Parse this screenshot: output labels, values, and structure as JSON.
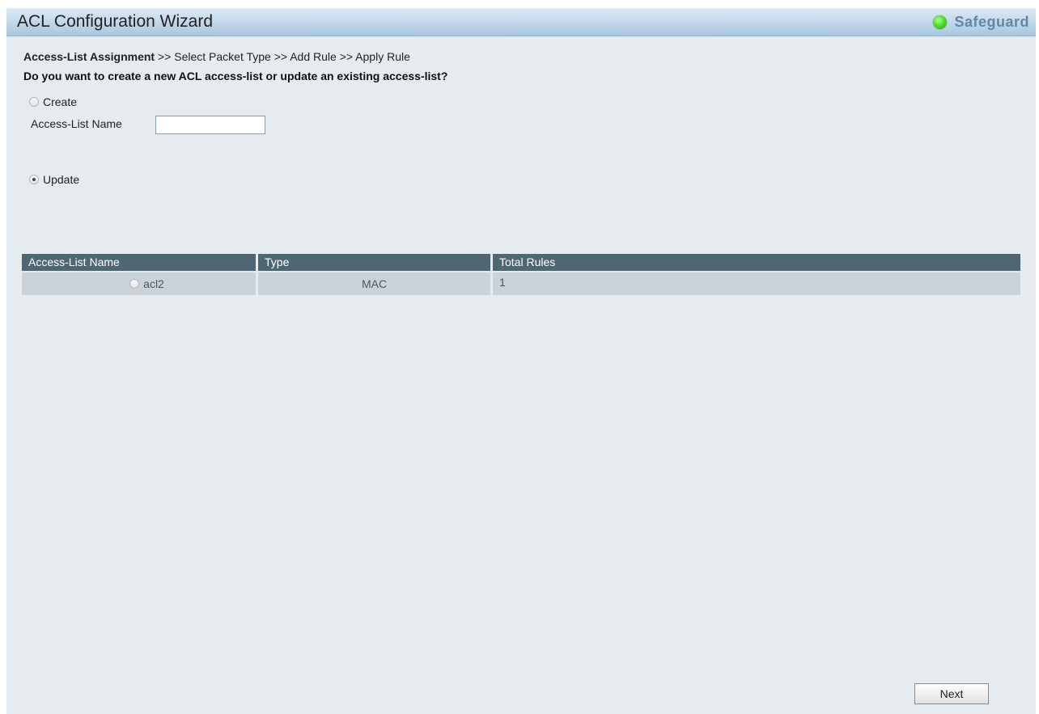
{
  "window": {
    "title": "ACL Configuration Wizard",
    "status_label": "Safeguard",
    "status_color": "#3fd12a"
  },
  "wizard": {
    "steps": [
      "Access-List Assignment",
      "Select Packet Type",
      "Add Rule",
      "Apply Rule"
    ],
    "separator": ">>",
    "current_step": "Access-List Assignment",
    "question": "Do you want to create a new ACL access-list or update an existing access-list?"
  },
  "options": {
    "create_label": "Create",
    "create_selected": false,
    "name_label": "Access-List Name",
    "name_value": "",
    "update_label": "Update",
    "update_selected": true
  },
  "table": {
    "headers": [
      "Access-List Name",
      "Type",
      "Total Rules"
    ],
    "rows": [
      {
        "name": "acl2",
        "type": "MAC",
        "total_rules": "1",
        "selected": false
      }
    ]
  },
  "buttons": {
    "next_label": "Next"
  }
}
